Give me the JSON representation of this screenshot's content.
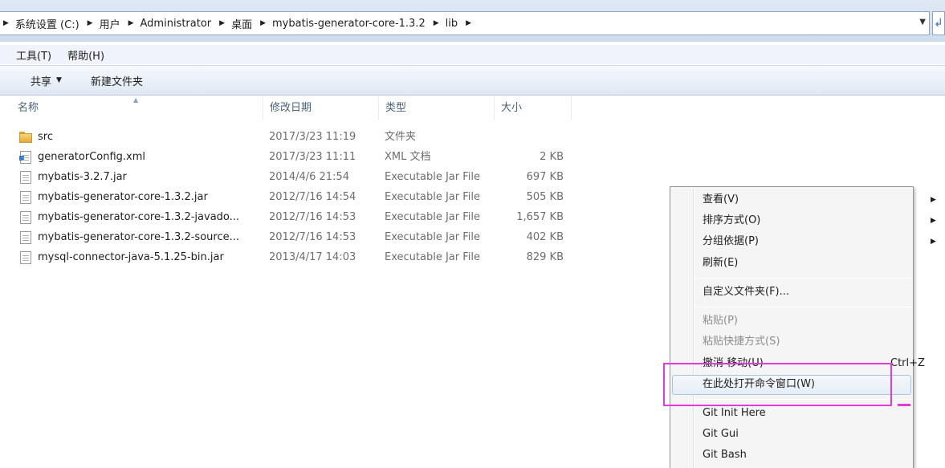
{
  "address_bar": {
    "crumbs": [
      "系统设置 (C:)",
      "用户",
      "Administrator",
      "桌面",
      "mybatis-generator-core-1.3.2",
      "lib"
    ]
  },
  "menubar": {
    "items": [
      "工具(T)",
      "帮助(H)"
    ]
  },
  "toolbar": {
    "share_label": "共享",
    "new_folder_label": "新建文件夹"
  },
  "columns": {
    "name": "名称",
    "date": "修改日期",
    "type": "类型",
    "size": "大小"
  },
  "files": [
    {
      "icon": "folder-icon",
      "name": "src",
      "date": "2017/3/23 11:19",
      "type": "文件夹",
      "size": ""
    },
    {
      "icon": "xml-file-icon",
      "name": "generatorConfig.xml",
      "date": "2017/3/23 11:11",
      "type": "XML 文档",
      "size": "2 KB"
    },
    {
      "icon": "jar-file-icon",
      "name": "mybatis-3.2.7.jar",
      "date": "2014/4/6 21:54",
      "type": "Executable Jar File",
      "size": "697 KB"
    },
    {
      "icon": "jar-file-icon",
      "name": "mybatis-generator-core-1.3.2.jar",
      "date": "2012/7/16 14:54",
      "type": "Executable Jar File",
      "size": "505 KB"
    },
    {
      "icon": "jar-file-icon",
      "name": "mybatis-generator-core-1.3.2-javado...",
      "date": "2012/7/16 14:53",
      "type": "Executable Jar File",
      "size": "1,657 KB"
    },
    {
      "icon": "jar-file-icon",
      "name": "mybatis-generator-core-1.3.2-source...",
      "date": "2012/7/16 14:53",
      "type": "Executable Jar File",
      "size": "402 KB"
    },
    {
      "icon": "jar-file-icon",
      "name": "mysql-connector-java-5.1.25-bin.jar",
      "date": "2013/4/17 14:03",
      "type": "Executable Jar File",
      "size": "829 KB"
    }
  ],
  "context_menu": {
    "view": "查看(V)",
    "sort": "排序方式(O)",
    "group": "分组依据(P)",
    "refresh": "刷新(E)",
    "customize": "自定义文件夹(F)...",
    "paste": "粘贴(P)",
    "paste_shortcut": "粘贴快捷方式(S)",
    "undo_move": "撤消 移动(U)",
    "undo_shortcut": "Ctrl+Z",
    "open_cmd": "在此处打开命令窗口(W)",
    "git_init": "Git Init Here",
    "git_gui": "Git Gui",
    "git_bash": "Git Bash"
  },
  "colors": {
    "annotation": "#e03cd8",
    "highlight_border": "#a8c4e4"
  }
}
